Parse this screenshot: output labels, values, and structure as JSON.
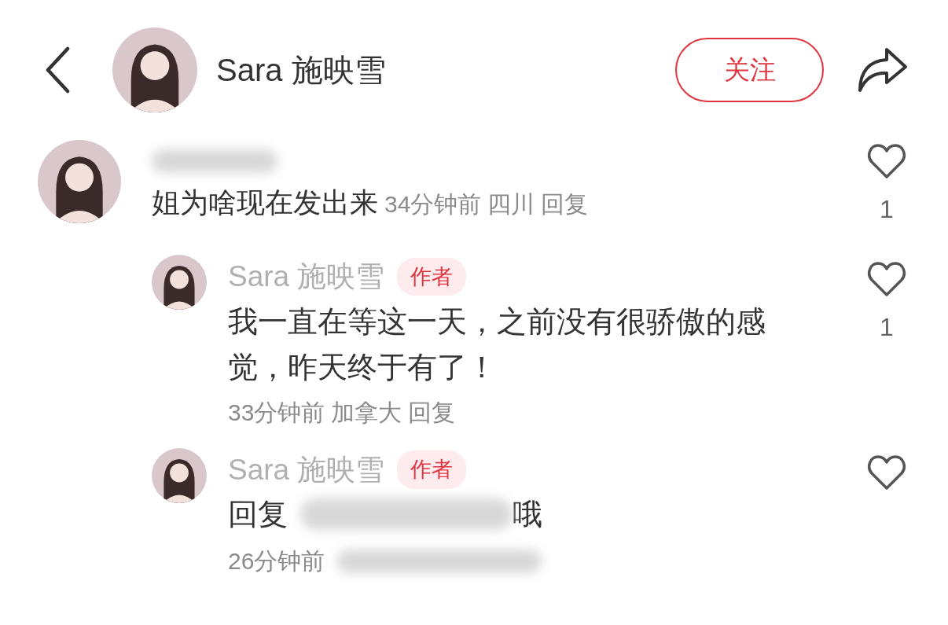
{
  "header": {
    "author": "Sara 施映雪",
    "follow_button": "关注"
  },
  "comments": [
    {
      "redacted_name": true,
      "text": "姐为啥现在发出来",
      "time": "34分钟前",
      "location": "四川",
      "reply_action": "回复",
      "likes": "1",
      "liked": false,
      "replies": [
        {
          "name": "Sara 施映雪",
          "badge": "作者",
          "text": "我一直在等这一天，之前没有很骄傲的感觉，昨天终于有了！",
          "time": "33分钟前",
          "location": "加拿大",
          "reply_action": "回复",
          "likes": "1",
          "liked": false
        },
        {
          "name": "Sara 施映雪",
          "badge": "作者",
          "text": "回复",
          "redacted_mention": true,
          "text_after": "哦",
          "time": "26分钟前",
          "redacted_meta": true,
          "liked": false
        }
      ]
    }
  ]
}
